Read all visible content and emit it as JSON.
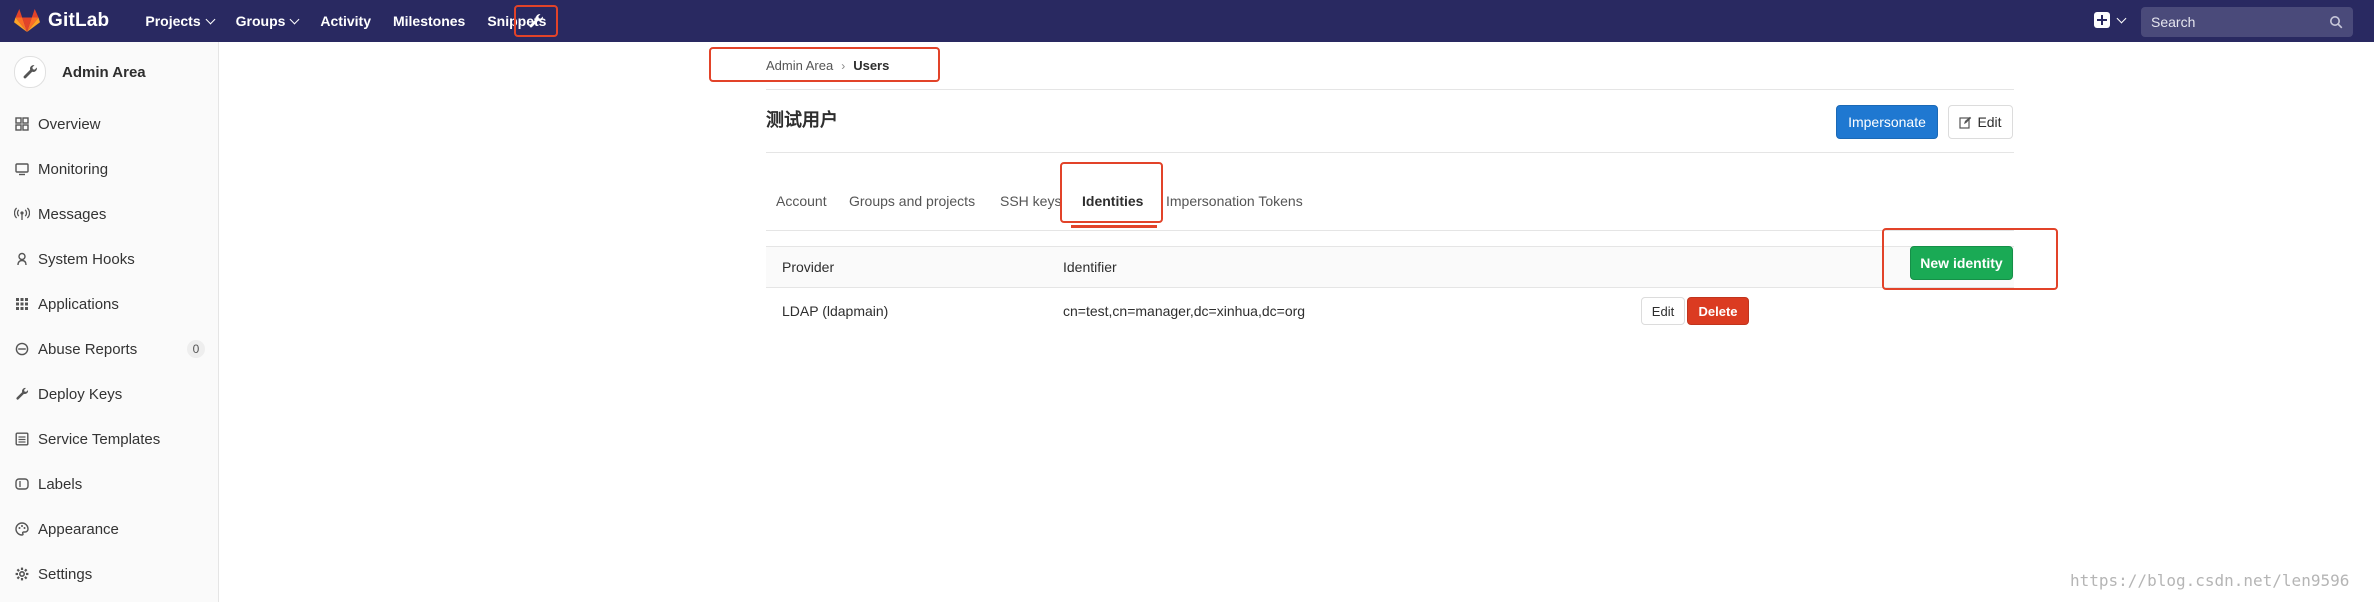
{
  "brand": {
    "name": "GitLab"
  },
  "nav": {
    "items": [
      {
        "label": "Projects"
      },
      {
        "label": "Groups"
      },
      {
        "label": "Activity"
      },
      {
        "label": "Milestones"
      },
      {
        "label": "Snippets"
      }
    ],
    "search_placeholder": "Search"
  },
  "sidebar": {
    "title": "Admin Area",
    "items": [
      {
        "label": "Overview",
        "icon": "overview-icon"
      },
      {
        "label": "Monitoring",
        "icon": "monitor-icon"
      },
      {
        "label": "Messages",
        "icon": "broadcast-icon"
      },
      {
        "label": "System Hooks",
        "icon": "hook-icon"
      },
      {
        "label": "Applications",
        "icon": "applications-icon"
      },
      {
        "label": "Abuse Reports",
        "icon": "abuse-icon",
        "badge": "0"
      },
      {
        "label": "Deploy Keys",
        "icon": "key-icon"
      },
      {
        "label": "Service Templates",
        "icon": "template-icon"
      },
      {
        "label": "Labels",
        "icon": "labels-icon"
      },
      {
        "label": "Appearance",
        "icon": "palette-icon"
      },
      {
        "label": "Settings",
        "icon": "gear-icon"
      }
    ]
  },
  "breadcrumb": {
    "parent": "Admin Area",
    "current": "Users"
  },
  "page": {
    "title": "测试用户",
    "impersonate_label": "Impersonate",
    "edit_label": "Edit"
  },
  "tabs": [
    {
      "label": "Account"
    },
    {
      "label": "Groups and projects"
    },
    {
      "label": "SSH keys"
    },
    {
      "label": "Identities",
      "active": true
    },
    {
      "label": "Impersonation Tokens"
    }
  ],
  "identities": {
    "new_button": "New identity",
    "columns": [
      "Provider",
      "Identifier"
    ],
    "rows": [
      {
        "provider": "LDAP (ldapmain)",
        "identifier": "cn=test,cn=manager,dc=xinhua,dc=org",
        "edit_label": "Edit",
        "delete_label": "Delete"
      }
    ]
  },
  "watermark": "https://blog.csdn.net/len9596",
  "colors": {
    "navbar": "#292961",
    "primary": "#1f78d1",
    "success": "#1aaa55",
    "danger": "#db3b21",
    "annotation": "#e24329"
  }
}
